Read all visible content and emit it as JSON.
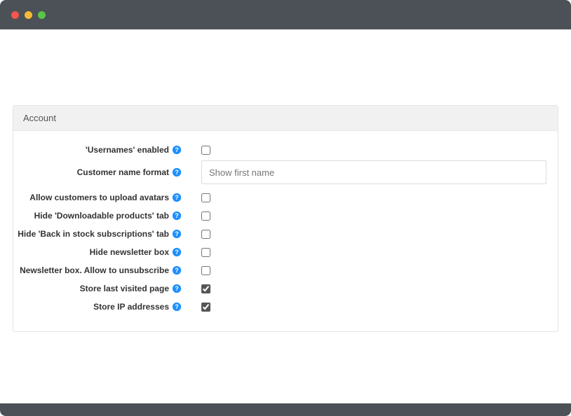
{
  "panel": {
    "title": "Account"
  },
  "fields": {
    "usernames_enabled": {
      "label": "'Usernames' enabled",
      "checked": false
    },
    "customer_name_format": {
      "label": "Customer name format",
      "value": "Show first name"
    },
    "allow_upload_avatars": {
      "label": "Allow customers to upload avatars",
      "checked": false
    },
    "hide_downloadable_products_tab": {
      "label": "Hide 'Downloadable products' tab",
      "checked": false
    },
    "hide_back_in_stock_tab": {
      "label": "Hide 'Back in stock subscriptions' tab",
      "checked": false
    },
    "hide_newsletter_box": {
      "label": "Hide newsletter box",
      "checked": false
    },
    "newsletter_allow_unsubscribe": {
      "label": "Newsletter box. Allow to unsubscribe",
      "checked": false
    },
    "store_last_visited_page": {
      "label": "Store last visited page",
      "checked": true
    },
    "store_ip_addresses": {
      "label": "Store IP addresses",
      "checked": true
    }
  }
}
